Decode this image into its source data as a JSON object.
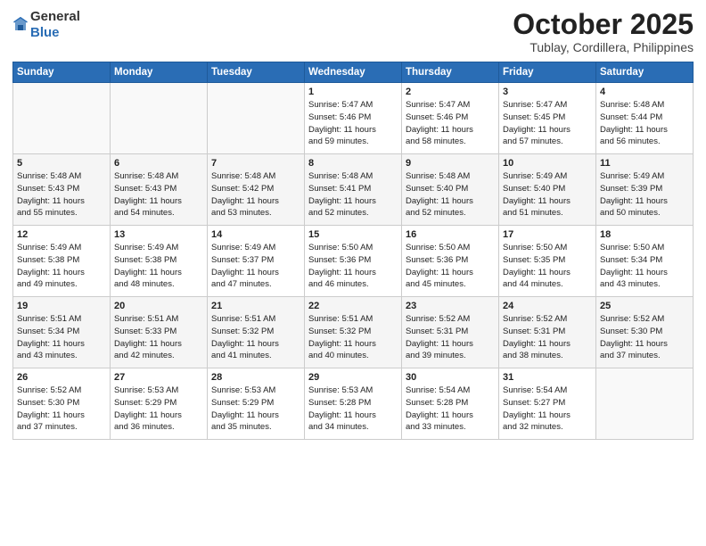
{
  "logo": {
    "general": "General",
    "blue": "Blue"
  },
  "header": {
    "month": "October 2025",
    "location": "Tublay, Cordillera, Philippines"
  },
  "weekdays": [
    "Sunday",
    "Monday",
    "Tuesday",
    "Wednesday",
    "Thursday",
    "Friday",
    "Saturday"
  ],
  "weeks": [
    [
      {
        "day": "",
        "info": ""
      },
      {
        "day": "",
        "info": ""
      },
      {
        "day": "",
        "info": ""
      },
      {
        "day": "1",
        "info": "Sunrise: 5:47 AM\nSunset: 5:46 PM\nDaylight: 11 hours\nand 59 minutes."
      },
      {
        "day": "2",
        "info": "Sunrise: 5:47 AM\nSunset: 5:46 PM\nDaylight: 11 hours\nand 58 minutes."
      },
      {
        "day": "3",
        "info": "Sunrise: 5:47 AM\nSunset: 5:45 PM\nDaylight: 11 hours\nand 57 minutes."
      },
      {
        "day": "4",
        "info": "Sunrise: 5:48 AM\nSunset: 5:44 PM\nDaylight: 11 hours\nand 56 minutes."
      }
    ],
    [
      {
        "day": "5",
        "info": "Sunrise: 5:48 AM\nSunset: 5:43 PM\nDaylight: 11 hours\nand 55 minutes."
      },
      {
        "day": "6",
        "info": "Sunrise: 5:48 AM\nSunset: 5:43 PM\nDaylight: 11 hours\nand 54 minutes."
      },
      {
        "day": "7",
        "info": "Sunrise: 5:48 AM\nSunset: 5:42 PM\nDaylight: 11 hours\nand 53 minutes."
      },
      {
        "day": "8",
        "info": "Sunrise: 5:48 AM\nSunset: 5:41 PM\nDaylight: 11 hours\nand 52 minutes."
      },
      {
        "day": "9",
        "info": "Sunrise: 5:48 AM\nSunset: 5:40 PM\nDaylight: 11 hours\nand 52 minutes."
      },
      {
        "day": "10",
        "info": "Sunrise: 5:49 AM\nSunset: 5:40 PM\nDaylight: 11 hours\nand 51 minutes."
      },
      {
        "day": "11",
        "info": "Sunrise: 5:49 AM\nSunset: 5:39 PM\nDaylight: 11 hours\nand 50 minutes."
      }
    ],
    [
      {
        "day": "12",
        "info": "Sunrise: 5:49 AM\nSunset: 5:38 PM\nDaylight: 11 hours\nand 49 minutes."
      },
      {
        "day": "13",
        "info": "Sunrise: 5:49 AM\nSunset: 5:38 PM\nDaylight: 11 hours\nand 48 minutes."
      },
      {
        "day": "14",
        "info": "Sunrise: 5:49 AM\nSunset: 5:37 PM\nDaylight: 11 hours\nand 47 minutes."
      },
      {
        "day": "15",
        "info": "Sunrise: 5:50 AM\nSunset: 5:36 PM\nDaylight: 11 hours\nand 46 minutes."
      },
      {
        "day": "16",
        "info": "Sunrise: 5:50 AM\nSunset: 5:36 PM\nDaylight: 11 hours\nand 45 minutes."
      },
      {
        "day": "17",
        "info": "Sunrise: 5:50 AM\nSunset: 5:35 PM\nDaylight: 11 hours\nand 44 minutes."
      },
      {
        "day": "18",
        "info": "Sunrise: 5:50 AM\nSunset: 5:34 PM\nDaylight: 11 hours\nand 43 minutes."
      }
    ],
    [
      {
        "day": "19",
        "info": "Sunrise: 5:51 AM\nSunset: 5:34 PM\nDaylight: 11 hours\nand 43 minutes."
      },
      {
        "day": "20",
        "info": "Sunrise: 5:51 AM\nSunset: 5:33 PM\nDaylight: 11 hours\nand 42 minutes."
      },
      {
        "day": "21",
        "info": "Sunrise: 5:51 AM\nSunset: 5:32 PM\nDaylight: 11 hours\nand 41 minutes."
      },
      {
        "day": "22",
        "info": "Sunrise: 5:51 AM\nSunset: 5:32 PM\nDaylight: 11 hours\nand 40 minutes."
      },
      {
        "day": "23",
        "info": "Sunrise: 5:52 AM\nSunset: 5:31 PM\nDaylight: 11 hours\nand 39 minutes."
      },
      {
        "day": "24",
        "info": "Sunrise: 5:52 AM\nSunset: 5:31 PM\nDaylight: 11 hours\nand 38 minutes."
      },
      {
        "day": "25",
        "info": "Sunrise: 5:52 AM\nSunset: 5:30 PM\nDaylight: 11 hours\nand 37 minutes."
      }
    ],
    [
      {
        "day": "26",
        "info": "Sunrise: 5:52 AM\nSunset: 5:30 PM\nDaylight: 11 hours\nand 37 minutes."
      },
      {
        "day": "27",
        "info": "Sunrise: 5:53 AM\nSunset: 5:29 PM\nDaylight: 11 hours\nand 36 minutes."
      },
      {
        "day": "28",
        "info": "Sunrise: 5:53 AM\nSunset: 5:29 PM\nDaylight: 11 hours\nand 35 minutes."
      },
      {
        "day": "29",
        "info": "Sunrise: 5:53 AM\nSunset: 5:28 PM\nDaylight: 11 hours\nand 34 minutes."
      },
      {
        "day": "30",
        "info": "Sunrise: 5:54 AM\nSunset: 5:28 PM\nDaylight: 11 hours\nand 33 minutes."
      },
      {
        "day": "31",
        "info": "Sunrise: 5:54 AM\nSunset: 5:27 PM\nDaylight: 11 hours\nand 32 minutes."
      },
      {
        "day": "",
        "info": ""
      }
    ]
  ]
}
